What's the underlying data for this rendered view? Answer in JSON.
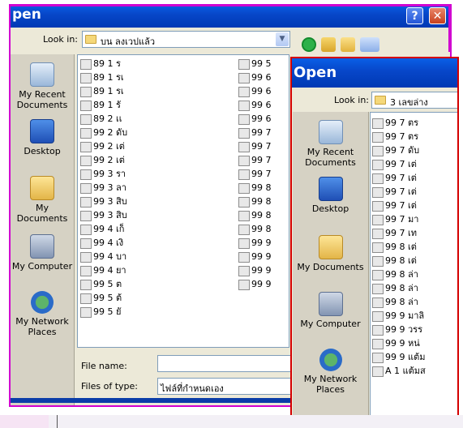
{
  "dialog_back": {
    "title": "pen",
    "look_in_label": "Look in:",
    "look_in_value": "บน ลงเวปแล้ว",
    "places": [
      "My Recent Documents",
      "Desktop",
      "My Documents",
      "My Computer",
      "My Network Places"
    ],
    "files_col1": [
      "89 1 ร",
      "89 1 รเ",
      "89 1 รเ",
      "89 1 รั",
      "89 2 เเ",
      "99 2 ดับ",
      "99 2 เต่",
      "99 2 เต่",
      "99 3 รา",
      "99 3 ลา",
      "99 3 สิบ",
      "99 3 สิบ",
      "99 4 เก็",
      "99 4 เงิ",
      "99 4 บา",
      "99 4 ยา",
      "99 5 ต",
      "99 5 ต้",
      "99 5 ยั"
    ],
    "files_col2": [
      "99 5",
      "99 6",
      "99 6",
      "99 6",
      "99 6",
      "99 7",
      "99 7",
      "99 7",
      "99 7",
      "99 8",
      "99 8",
      "99 8",
      "99 8",
      "99 9",
      "99 9",
      "99 9",
      "99 9"
    ],
    "file_name_label": "File name:",
    "file_name_value": "",
    "files_of_type_label": "Files of type:",
    "files_of_type_value": "ไฟล์ที่กำหนดเอง"
  },
  "dialog_front": {
    "title": "Open",
    "look_in_label": "Look in:",
    "look_in_value": "3 เลขล่าง",
    "places": [
      "My Recent Documents",
      "Desktop",
      "My Documents",
      "My Computer",
      "My Network Places"
    ],
    "files": [
      "99 7 ตร",
      "99 7 ตร",
      "99 7 ดับ",
      "99 7 เต่",
      "99 7 เต่",
      "99 7 เต่",
      "99 7 เต่",
      "99 7 มา",
      "99 7 เท",
      "99 8 เต่",
      "99 8 เต่",
      "99 8 ล่า",
      "99 8 ล่า",
      "99 8 ล่า",
      "99 9 มาลิ",
      "99 9 วรร",
      "99 9 หน่",
      "99 9 แต้ม",
      "A 1 แต้มส"
    ]
  },
  "icons": {
    "file_icon": "jpg-file-icon",
    "back": "back-arrow-icon",
    "up": "up-folder-icon",
    "new_folder": "new-folder-icon",
    "views": "views-menu-icon",
    "help": "help-icon",
    "close": "close-icon"
  },
  "icon_glyphs": {
    "help": "?",
    "close": "✕",
    "dropdown": "▼"
  },
  "colors": {
    "title_bar": "#0746c8",
    "dialog_bg": "#ece9d8",
    "highlight_magenta": "#d000d0",
    "highlight_red": "#d40000"
  }
}
